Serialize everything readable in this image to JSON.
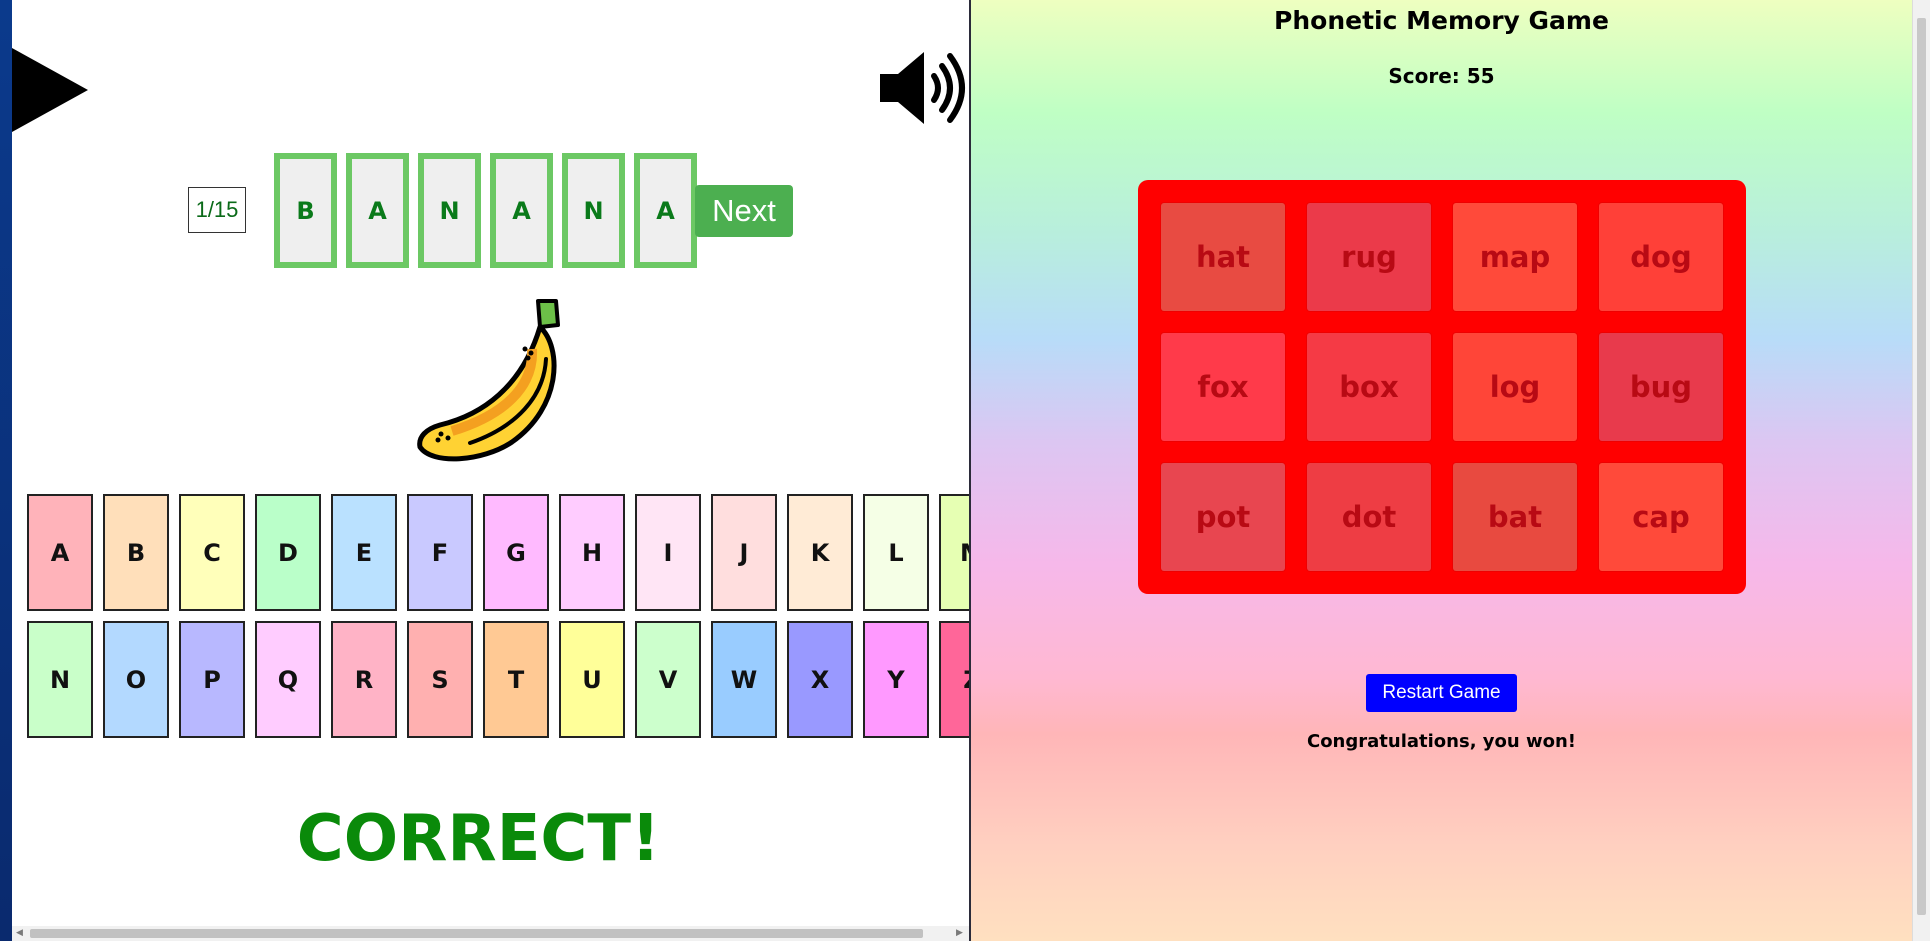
{
  "spelling": {
    "counter": "1/15",
    "letters": [
      "B",
      "A",
      "N",
      "A",
      "N",
      "A"
    ],
    "next_label": "Next",
    "result": "CORRECT!",
    "icons": {
      "play": "play-icon",
      "speaker": "speaker-icon",
      "image": "banana"
    },
    "slot_border_color": "#6cc864"
  },
  "alphabet": {
    "row1": [
      {
        "letter": "A",
        "color": "#ffb3ba"
      },
      {
        "letter": "B",
        "color": "#ffdfba"
      },
      {
        "letter": "C",
        "color": "#ffffba"
      },
      {
        "letter": "D",
        "color": "#baffc9"
      },
      {
        "letter": "E",
        "color": "#bae1ff"
      },
      {
        "letter": "F",
        "color": "#c9c9ff"
      },
      {
        "letter": "G",
        "color": "#ffbaff"
      },
      {
        "letter": "H",
        "color": "#ffccff"
      },
      {
        "letter": "I",
        "color": "#ffe5f5"
      },
      {
        "letter": "J",
        "color": "#ffdede"
      },
      {
        "letter": "K",
        "color": "#ffebd6"
      },
      {
        "letter": "L",
        "color": "#f5ffe6"
      },
      {
        "letter": "M",
        "color": "#e6ffb3"
      }
    ],
    "row2": [
      {
        "letter": "N",
        "color": "#c9ffc9"
      },
      {
        "letter": "O",
        "color": "#b3d9ff"
      },
      {
        "letter": "P",
        "color": "#b8b8ff"
      },
      {
        "letter": "Q",
        "color": "#ffccff"
      },
      {
        "letter": "R",
        "color": "#ffb3c6"
      },
      {
        "letter": "S",
        "color": "#ffb0b0"
      },
      {
        "letter": "T",
        "color": "#ffc994"
      },
      {
        "letter": "U",
        "color": "#ffff99"
      },
      {
        "letter": "V",
        "color": "#ccffcc"
      },
      {
        "letter": "W",
        "color": "#99ccff"
      },
      {
        "letter": "X",
        "color": "#9999ff"
      },
      {
        "letter": "Y",
        "color": "#ff99ff"
      },
      {
        "letter": "Z",
        "color": "#ff6699"
      }
    ]
  },
  "memory": {
    "title": "Phonetic Memory Game",
    "score": "Score: 55",
    "cards": [
      {
        "word": "hat",
        "color": "#e84b42"
      },
      {
        "word": "rug",
        "color": "#eb3a4a"
      },
      {
        "word": "map",
        "color": "#ff4a3a"
      },
      {
        "word": "dog",
        "color": "#ff4038"
      },
      {
        "word": "fox",
        "color": "#ff3a4a"
      },
      {
        "word": "box",
        "color": "#f53a45"
      },
      {
        "word": "log",
        "color": "#ff4538"
      },
      {
        "word": "bug",
        "color": "#e83a4c"
      },
      {
        "word": "pot",
        "color": "#e84650"
      },
      {
        "word": "dot",
        "color": "#ee3d44"
      },
      {
        "word": "bat",
        "color": "#e84a40"
      },
      {
        "word": "cap",
        "color": "#ff4a3a"
      }
    ],
    "board_color": "#ff0000",
    "restart_label": "Restart Game",
    "win_message": "Congratulations, you won!"
  }
}
